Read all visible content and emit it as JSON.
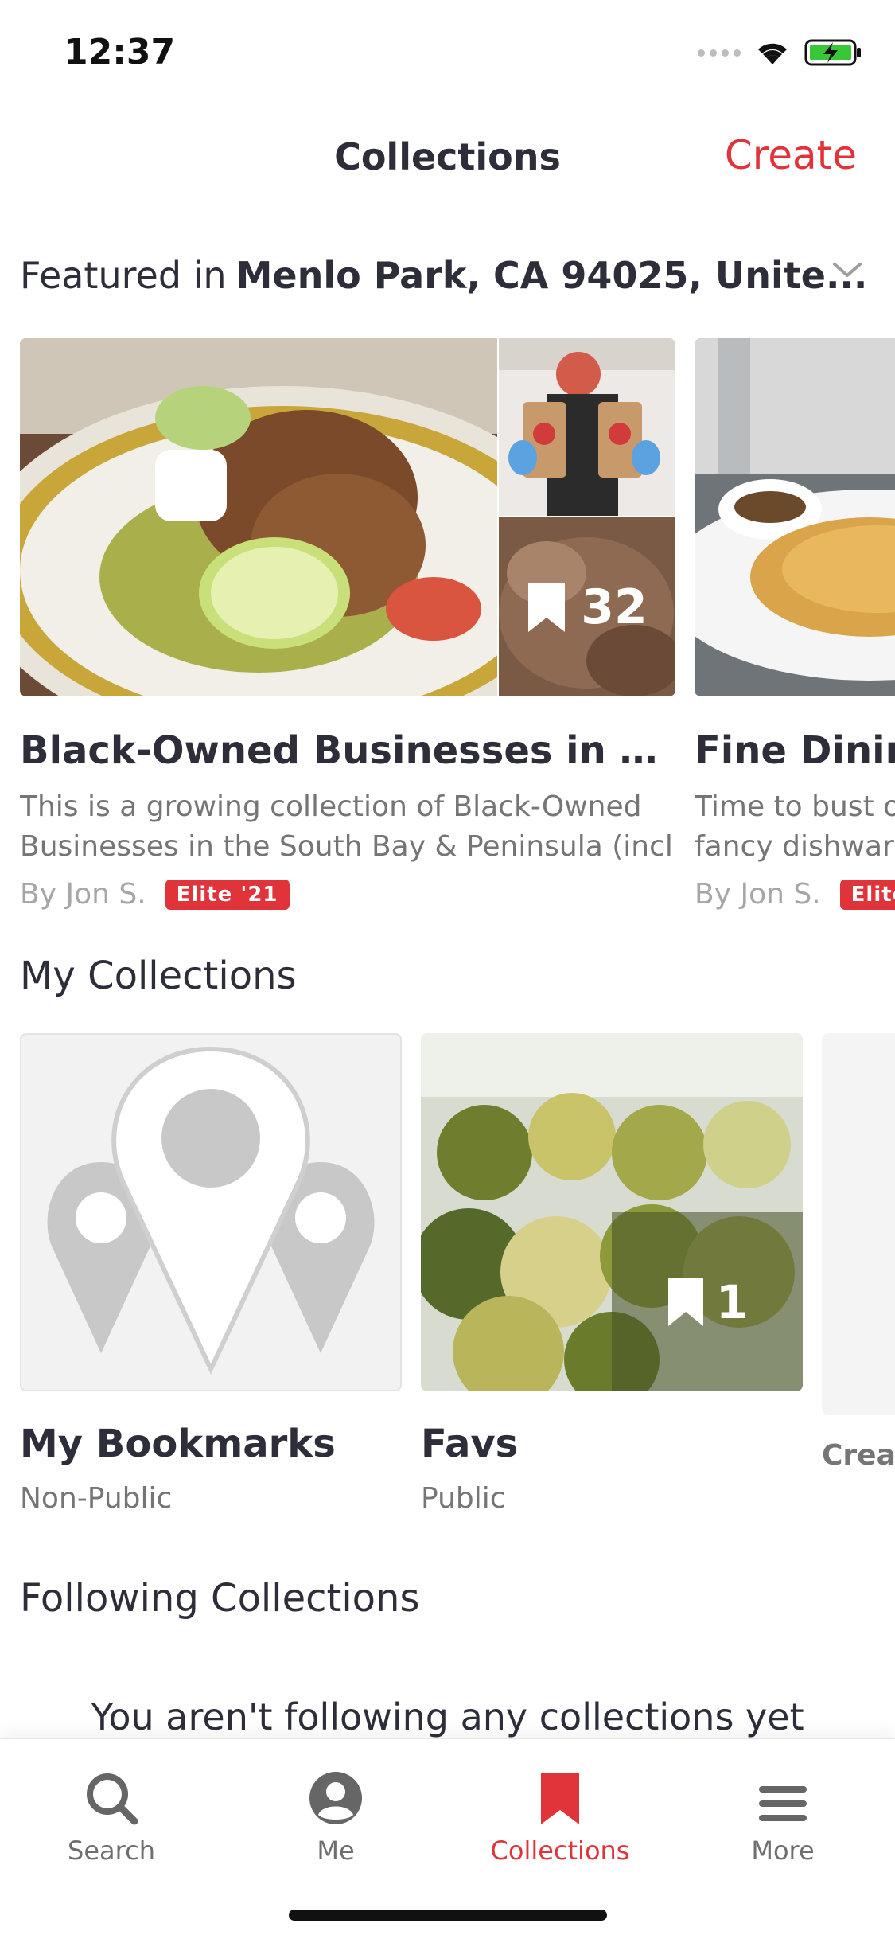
{
  "status_bar": {
    "time": "12:37"
  },
  "header": {
    "title": "Collections",
    "create_label": "Create"
  },
  "location": {
    "prefix": "Featured in",
    "value": "Menlo Park, CA 94025, Unite..."
  },
  "featured": [
    {
      "title": "Black-Owned Businesses in the S...",
      "description": "This is a growing collection of Black-Owned Businesses in the South Bay & Peninsula (incl S...",
      "by": "By Jon S.",
      "badge": "Elite '21",
      "count": "32"
    },
    {
      "title": "Fine Dining",
      "description": "Time to bust out the fancy dishware... Bring",
      "by": "By Jon S.",
      "badge": "Elite"
    }
  ],
  "my_collections": {
    "title": "My Collections",
    "items": [
      {
        "title": "My Bookmarks",
        "subtitle": "Non-Public"
      },
      {
        "title": "Favs",
        "subtitle": "Public",
        "count": "1"
      }
    ],
    "create_label": "Create"
  },
  "following": {
    "title": "Following Collections",
    "empty_text": "You aren't following any collections yet"
  },
  "tabs": [
    {
      "label": "Search",
      "icon": "search-icon"
    },
    {
      "label": "Me",
      "icon": "profile-icon"
    },
    {
      "label": "Collections",
      "icon": "bookmark-icon",
      "active": true
    },
    {
      "label": "More",
      "icon": "menu-icon"
    }
  ],
  "colors": {
    "accent": "#e0333a",
    "text": "#2d2e3a",
    "muted": "#757575"
  }
}
